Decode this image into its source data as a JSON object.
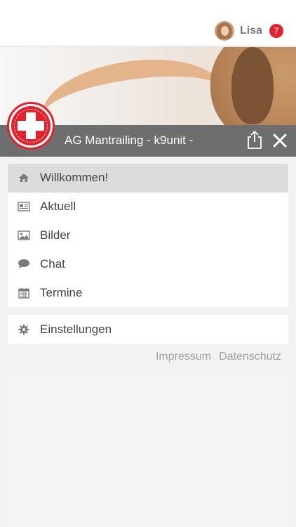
{
  "header": {
    "user_name": "Lisa",
    "notification_count": "7"
  },
  "group": {
    "title": "AG Mantrailing - k9unit -"
  },
  "menu": {
    "items": [
      {
        "label": "Willkommen!",
        "icon": "home-icon",
        "active": true
      },
      {
        "label": "Aktuell",
        "icon": "newspaper-icon",
        "active": false
      },
      {
        "label": "Bilder",
        "icon": "image-icon",
        "active": false
      },
      {
        "label": "Chat",
        "icon": "chat-bubble-icon",
        "active": false
      },
      {
        "label": "Termine",
        "icon": "calendar-icon",
        "active": false
      }
    ],
    "settings_label": "Einstellungen"
  },
  "footer": {
    "impressum": "Impressum",
    "datenschutz": "Datenschutz"
  },
  "colors": {
    "accent": "#e2232d",
    "titlebar": "#6e6e6e",
    "background": "#f2f2f2"
  }
}
